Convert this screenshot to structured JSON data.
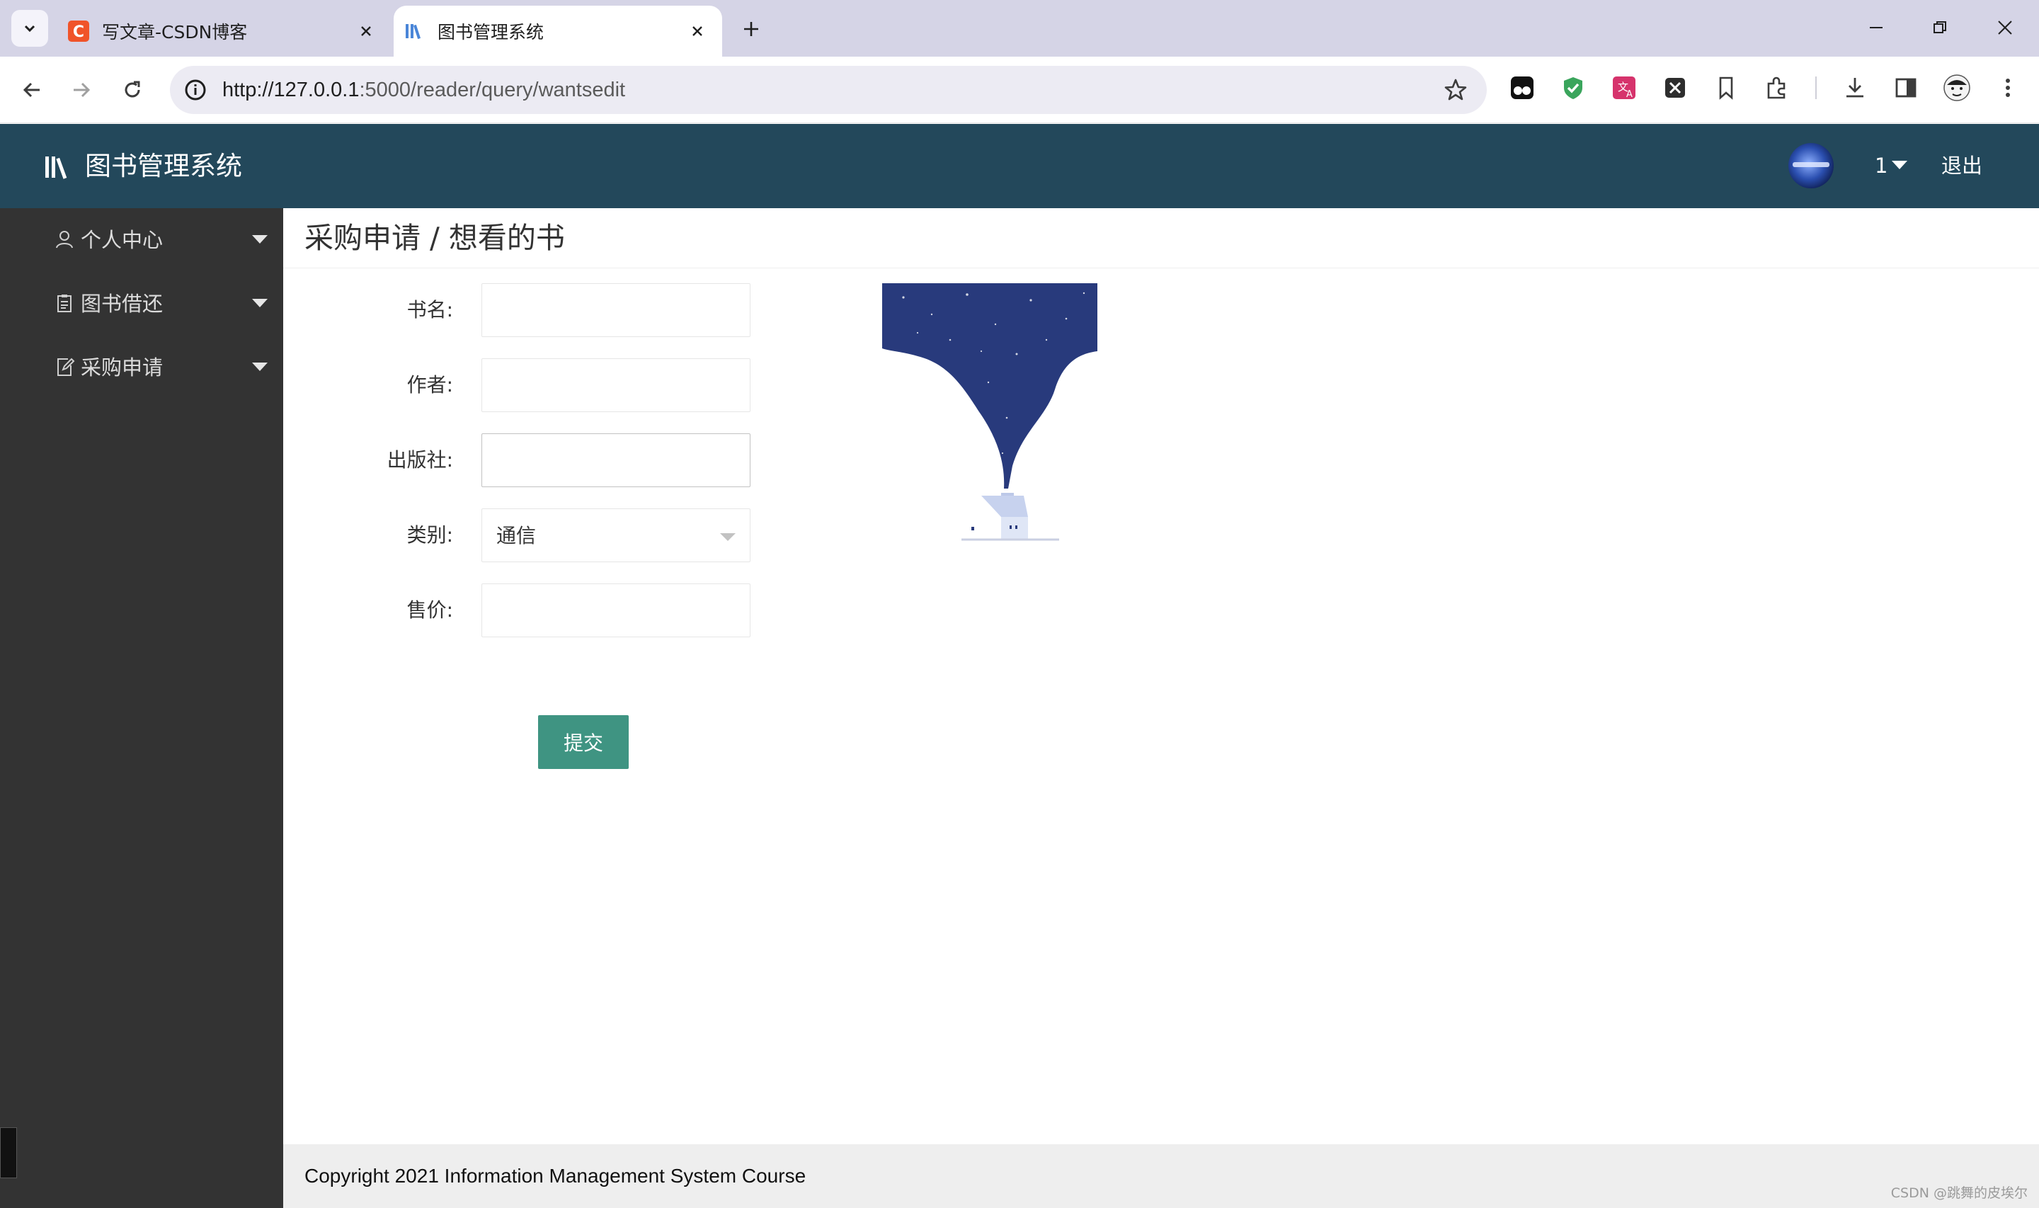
{
  "browser": {
    "tabs": [
      {
        "title": "写文章-CSDN博客",
        "active": false,
        "favicon": "csdn-favicon"
      },
      {
        "title": "图书管理系统",
        "active": true,
        "favicon": "books-favicon"
      }
    ],
    "url_host": "http://127.0.0.1",
    "url_path": ":5000/reader/query/wantsedit",
    "extensions": [
      "tampermonkey-icon",
      "shield-check-icon",
      "translate-icon",
      "x-extension-icon",
      "bookmark-icon",
      "puzzle-icon",
      "download-icon",
      "sidepanel-icon",
      "profile-icon",
      "kebab-menu-icon"
    ]
  },
  "header": {
    "title": "图书管理系统",
    "user": "1",
    "logout": "退出"
  },
  "sidebar": {
    "items": [
      {
        "label": "个人中心",
        "icon": "user-icon"
      },
      {
        "label": "图书借还",
        "icon": "clipboard-icon"
      },
      {
        "label": "采购申请",
        "icon": "edit-icon"
      }
    ]
  },
  "main": {
    "title": "采购申请 / 想看的书",
    "form": {
      "book_name_label": "书名:",
      "book_name_value": "",
      "author_label": "作者:",
      "author_value": "",
      "publisher_label": "出版社:",
      "publisher_value": "",
      "category_label": "类别:",
      "category_value": "通信",
      "price_label": "售价:",
      "price_value": "",
      "submit_label": "提交"
    }
  },
  "footer": {
    "copyright": "Copyright 2021 Information Management System Course"
  },
  "watermark": "CSDN @跳舞的皮埃尔",
  "colors": {
    "header_bg": "#23485b",
    "sidebar_bg": "#333333",
    "submit_bg": "#3f9482",
    "tabstrip_bg": "#d5d4e6"
  }
}
